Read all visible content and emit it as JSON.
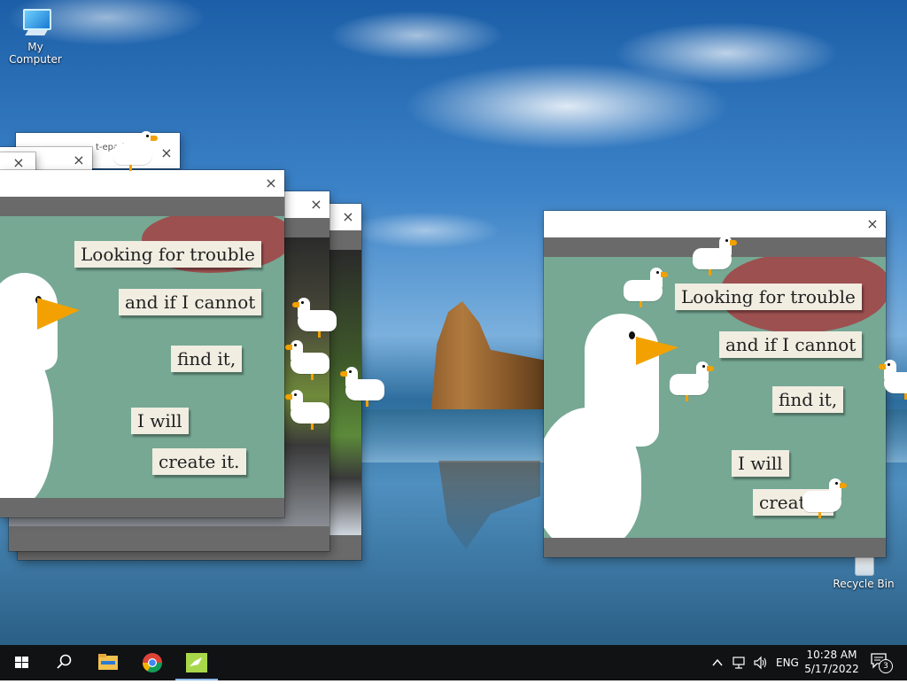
{
  "desktop": {
    "icons": {
      "my_computer": {
        "label": "My Computer",
        "icon": "computer-icon"
      },
      "recycle_bin": {
        "label": "Recycle Bin",
        "icon": "recycle-bin-icon"
      }
    }
  },
  "windows": {
    "back_window": {
      "title_partial": "t-epad"
    },
    "close_glyph": "×"
  },
  "poster": {
    "lines": [
      "Looking for trouble",
      "and if I cannot",
      "find it,",
      "I will",
      "create it."
    ],
    "right_partial_last": "create i"
  },
  "taskbar": {
    "icons": [
      "windows-start-icon",
      "search-icon",
      "file-explorer-icon",
      "chrome-icon",
      "notepad-icon"
    ],
    "tray": {
      "language": "ENG",
      "time": "10:28 AM",
      "date": "5/17/2022",
      "notification_count": "3"
    }
  },
  "colors": {
    "poster_bg": "#76a894",
    "blood": "#9d5050",
    "beak": "#f2a100",
    "taskbar": "#101214"
  }
}
